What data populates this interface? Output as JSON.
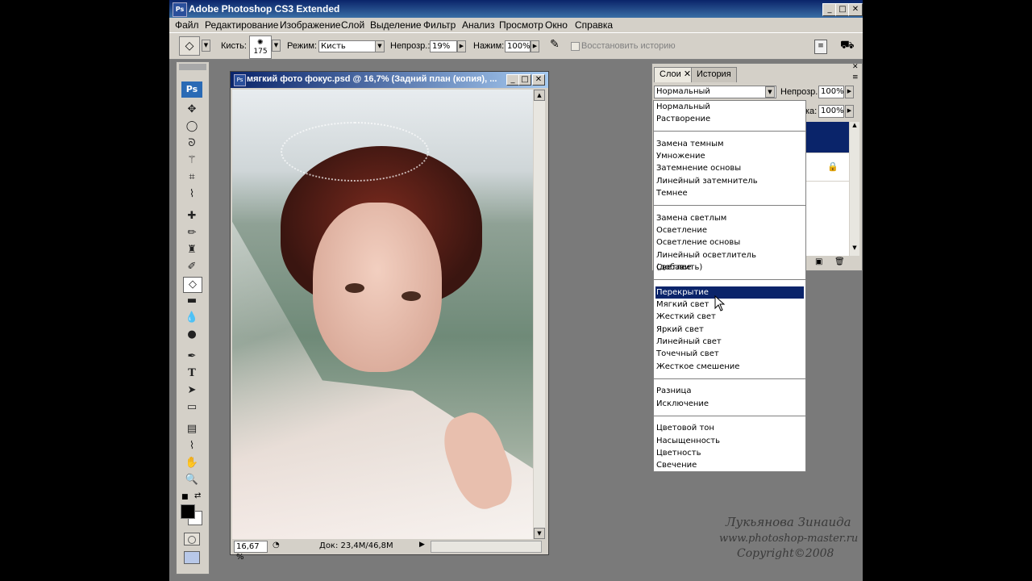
{
  "window": {
    "title": "Adobe Photoshop CS3 Extended",
    "logo_text": "Ps",
    "controls": [
      "_",
      "□",
      "✕"
    ]
  },
  "menu": [
    "Файл",
    "Редактирование",
    "Изображение",
    "Слой",
    "Выделение",
    "Фильтр",
    "Анализ",
    "Просмотр",
    "Окно",
    "Справка"
  ],
  "options_bar": {
    "brush_label": "Кисть:",
    "brush_size": "175",
    "mode_label": "Режим:",
    "mode_value": "Кисть",
    "opacity_label": "Непрозр.:",
    "opacity_value": "19%",
    "pressure_label": "Нажим:",
    "pressure_value": "100%",
    "history_label": "Восстановить историю"
  },
  "tools_panel": {
    "logo": "Ps",
    "tools": [
      "move-icon",
      "ellipse-marquee-icon",
      "lasso-icon",
      "magic-wand-icon",
      "crop-icon",
      "eyedropper-icon",
      "healing-brush-icon",
      "brush-icon",
      "clone-stamp-icon",
      "history-brush-icon",
      "eraser-icon",
      "gradient-icon",
      "blur-icon",
      "dodge-icon",
      "pen-icon",
      "type-icon",
      "path-select-icon",
      "rectangle-icon",
      "notes-icon",
      "color-sampler-icon",
      "hand-icon",
      "zoom-icon"
    ],
    "foreground_color": "#000000",
    "background_color": "#ffffff"
  },
  "document": {
    "title": "мягкий фото фокус.psd @ 16,7% (Задний план (копия), ...",
    "zoom": "16,67 %",
    "doc_info": "Док: 23,4M/46,8M"
  },
  "layers_panel": {
    "tabs": [
      "Слои",
      "История"
    ],
    "blend_mode": "Нормальный",
    "opacity_label": "Непрозр.:",
    "opacity_value": "100%",
    "fill_label_fragment": "ка:",
    "fill_value": "100%"
  },
  "blend_modes": {
    "groups": [
      [
        "Нормальный",
        "Растворение"
      ],
      [
        "Замена темным",
        "Умножение",
        "Затемнение основы",
        "Линейный затемнитель",
        "Темнее"
      ],
      [
        "Замена светлым",
        "Осветление",
        "Осветление основы",
        "Линейный осветлитель (добавить)",
        "Светлее"
      ],
      [
        "Перекрытие",
        "Мягкий свет",
        "Жесткий свет",
        "Яркий свет",
        "Линейный свет",
        "Точечный свет",
        "Жесткое смешение"
      ],
      [
        "Разница",
        "Исключение"
      ],
      [
        "Цветовой тон",
        "Насыщенность",
        "Цветность",
        "Свечение"
      ]
    ],
    "selected": "Перекрытие"
  },
  "watermark": {
    "author": "Лукьянова Зинаида",
    "site": "www.photoshop-master.ru",
    "copyright": "Copyright©2008"
  },
  "colors": {
    "titlebar": "#0a246a",
    "selection": "#0a246a",
    "chrome": "#d4d0c8"
  }
}
